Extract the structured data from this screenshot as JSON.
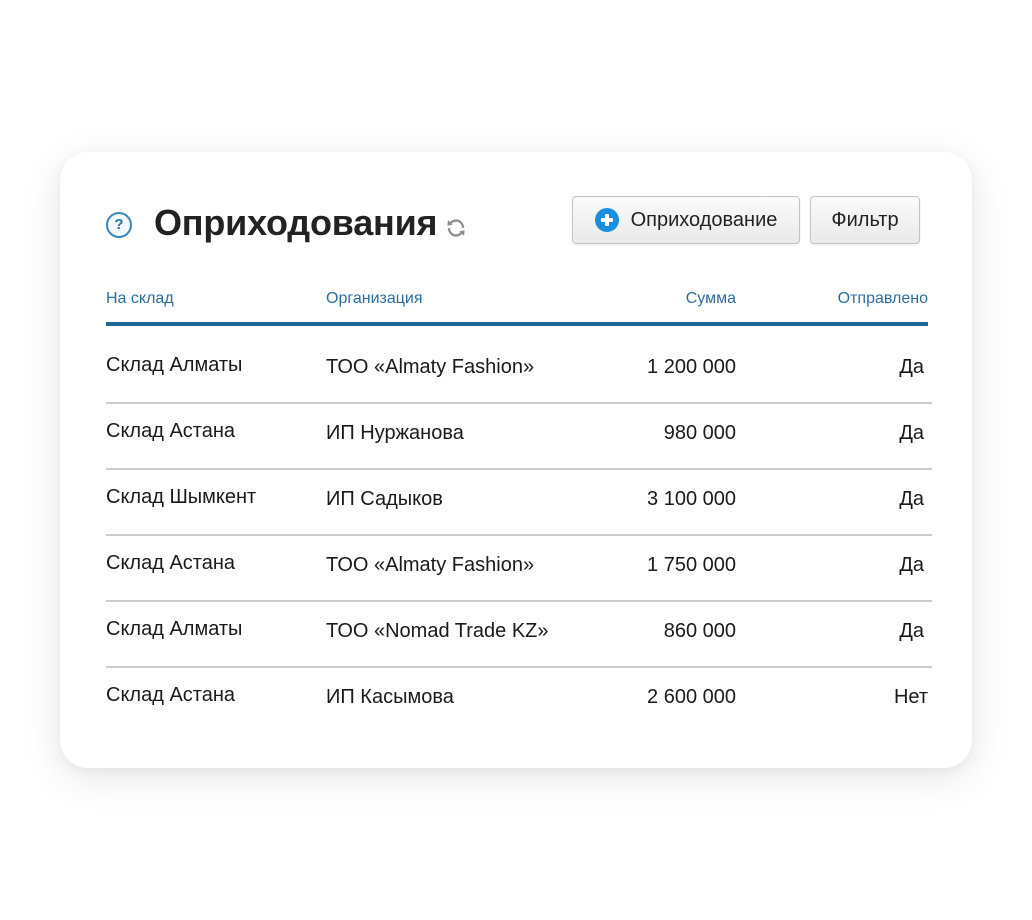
{
  "header": {
    "title": "Оприходования",
    "help_icon_text": "?",
    "add_button_label": "Оприходование",
    "filter_button_label": "Фильтр"
  },
  "icons": {
    "help": "question-circle-icon",
    "refresh": "refresh-icon",
    "add": "plus-circle-icon"
  },
  "colors": {
    "header_text": "#2b6e9e",
    "header_rule": "#1e6896",
    "add_icon": "#1a8fe0"
  },
  "table": {
    "columns": [
      "На склад",
      "Организация",
      "Сумма",
      "Отправлено"
    ],
    "rows": [
      {
        "warehouse": "Склад Алматы",
        "organization": "ТОО «Almaty Fashion»",
        "sum": "1 200 000",
        "sent": "Да"
      },
      {
        "warehouse": "Склад Астана",
        "organization": "ИП Нуржанова",
        "sum": "980 000",
        "sent": "Да"
      },
      {
        "warehouse": "Склад Шымкент",
        "organization": "ИП Садыков",
        "sum": "3 100 000",
        "sent": "Да"
      },
      {
        "warehouse": "Склад Астана",
        "organization": "ТОО «Almaty Fashion»",
        "sum": "1 750 000",
        "sent": "Да"
      },
      {
        "warehouse": "Склад Алматы",
        "organization": "ТОО «Nomad Trade KZ»",
        "sum": "860 000",
        "sent": "Да"
      },
      {
        "warehouse": "Склад Астана",
        "organization": "ИП Касымова",
        "sum": "2 600 000",
        "sent": "Нет"
      }
    ]
  }
}
